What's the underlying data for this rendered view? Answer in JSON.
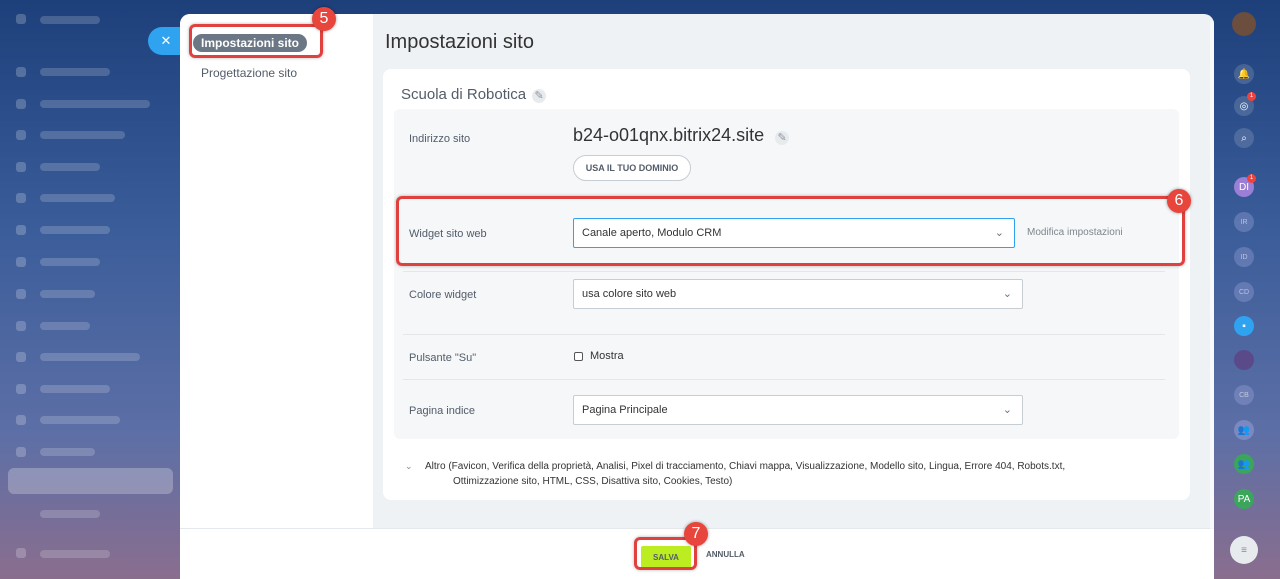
{
  "close_icon": "close-icon",
  "nav": {
    "active_item": "Impostazioni sito",
    "item2": "Progettazione sito"
  },
  "page_title": "Impostazioni sito",
  "site": {
    "name": "Scuola di Robotica"
  },
  "address": {
    "label": "Indirizzo sito",
    "value": "b24-o01qnx.bitrix24.site",
    "domain_button": "USA IL TUO DOMINIO"
  },
  "widget": {
    "label": "Widget sito web",
    "value": "Canale aperto, Modulo CRM",
    "edit_link": "Modifica impostazioni"
  },
  "widget_color": {
    "label": "Colore widget",
    "value": "usa colore sito web"
  },
  "up_button": {
    "label": "Pulsante \"Su\"",
    "checkbox_label": "Mostra"
  },
  "index_page": {
    "label": "Pagina indice",
    "value": "Pagina Principale"
  },
  "more": {
    "line1": "Altro (Favicon, Verifica della proprietà, Analisi, Pixel di tracciamento, Chiavi mappa, Visualizzazione, Modello sito, Lingua, Errore 404, Robots.txt,",
    "line2": "Ottimizzazione sito, HTML, CSS, Disattiva sito, Cookies, Testo)"
  },
  "footer": {
    "save": "SALVA",
    "cancel": "ANNULLA"
  },
  "callouts": [
    "5",
    "6",
    "7"
  ],
  "rail": {
    "badges": [
      "1",
      "1"
    ],
    "avatars": [
      "DI",
      "IR",
      "ID",
      "CD",
      "CB",
      "PA"
    ]
  },
  "colors": {
    "accent": "#2fa3f0",
    "save": "#bbed21",
    "callout": "#e0413f"
  }
}
